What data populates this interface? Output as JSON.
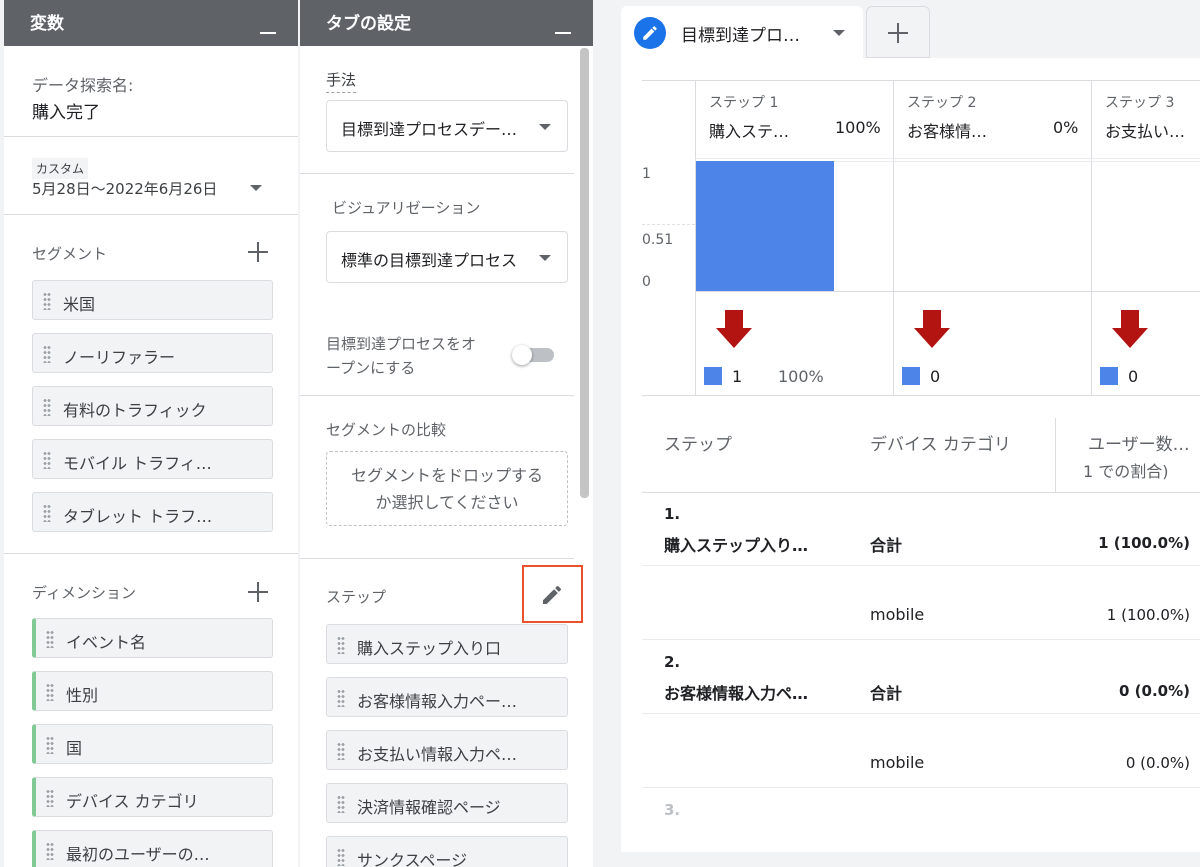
{
  "variables": {
    "title": "変数",
    "exploration_label": "データ探索名:",
    "exploration_name": "購入完了",
    "date_badge": "カスタム",
    "date_range": "5月28日～2022年6月26日",
    "segments_label": "セグメント",
    "segments": [
      "米国",
      "ノーリファラー",
      "有料のトラフィック",
      "モバイル トラフィ…",
      "タブレット トラフ…"
    ],
    "dimensions_label": "ディメンション",
    "dimensions": [
      "イベント名",
      "性別",
      "国",
      "デバイス カテゴリ",
      "最初のユーザーの…"
    ]
  },
  "settings": {
    "title": "タブの設定",
    "technique_label": "手法",
    "technique_value": "目標到達プロセスデー…",
    "visualization_label": "ビジュアリゼーション",
    "visualization_value": "標準の目標到達プロセス",
    "open_funnel_label": "目標到達プロセスをオープンにする",
    "open_funnel_label_line1": "目標到達プロセスをオ",
    "open_funnel_label_line2": "ープンにする",
    "open_funnel_on": false,
    "segment_compare_label": "セグメントの比較",
    "drop_zone_line1": "セグメントをドロップする",
    "drop_zone_line2": "か選択してください",
    "steps_label": "ステップ",
    "steps": [
      "購入ステップ入り口",
      "お客様情報入力ペー…",
      "お支払い情報入力ペ…",
      "決済情報確認ページ",
      "サンクスページ"
    ]
  },
  "tabs": {
    "active_tab_label": "目標到達プロ…",
    "add_tab_label": "+"
  },
  "funnel": {
    "steps": [
      {
        "header": "ステップ 1",
        "name": "購入ステ…",
        "pct": "100%",
        "count": "1",
        "count_pct": "100%"
      },
      {
        "header": "ステップ 2",
        "name": "お客様情…",
        "pct": "0%",
        "count": "0",
        "count_pct": ""
      },
      {
        "header": "ステップ 3",
        "name": "お支払い…",
        "pct": "",
        "count": "0",
        "count_pct": ""
      }
    ],
    "y_ticks": [
      "1",
      "0.51",
      "0"
    ],
    "bar_colors": {
      "bar": "#4c84e8",
      "arrow": "#b31412"
    }
  },
  "chart_data": {
    "type": "bar",
    "categories": [
      "ステップ 1",
      "ステップ 2",
      "ステップ 3"
    ],
    "values": [
      1,
      0,
      0
    ],
    "title": "",
    "xlabel": "",
    "ylabel": "",
    "ylim": [
      0,
      1
    ]
  },
  "table": {
    "headers": [
      "ステップ",
      "デバイス カテゴリ",
      "ユーザー数…",
      "1 での割合)"
    ],
    "rows": [
      {
        "step_num": "1.",
        "step_name": "購入ステップ入り…",
        "device": "合計",
        "value": "1 (100.0%)",
        "total": true
      },
      {
        "step_num": "",
        "step_name": "",
        "device": "mobile",
        "value": "1 (100.0%)",
        "total": false
      },
      {
        "step_num": "2.",
        "step_name": "お客様情報入力ペ…",
        "device": "合計",
        "value": "0 (0.0%)",
        "total": true
      },
      {
        "step_num": "",
        "step_name": "",
        "device": "mobile",
        "value": "0 (0.0%)",
        "total": false
      },
      {
        "step_num": "3.",
        "step_name": "",
        "device": "",
        "value": "",
        "total": true
      }
    ]
  }
}
